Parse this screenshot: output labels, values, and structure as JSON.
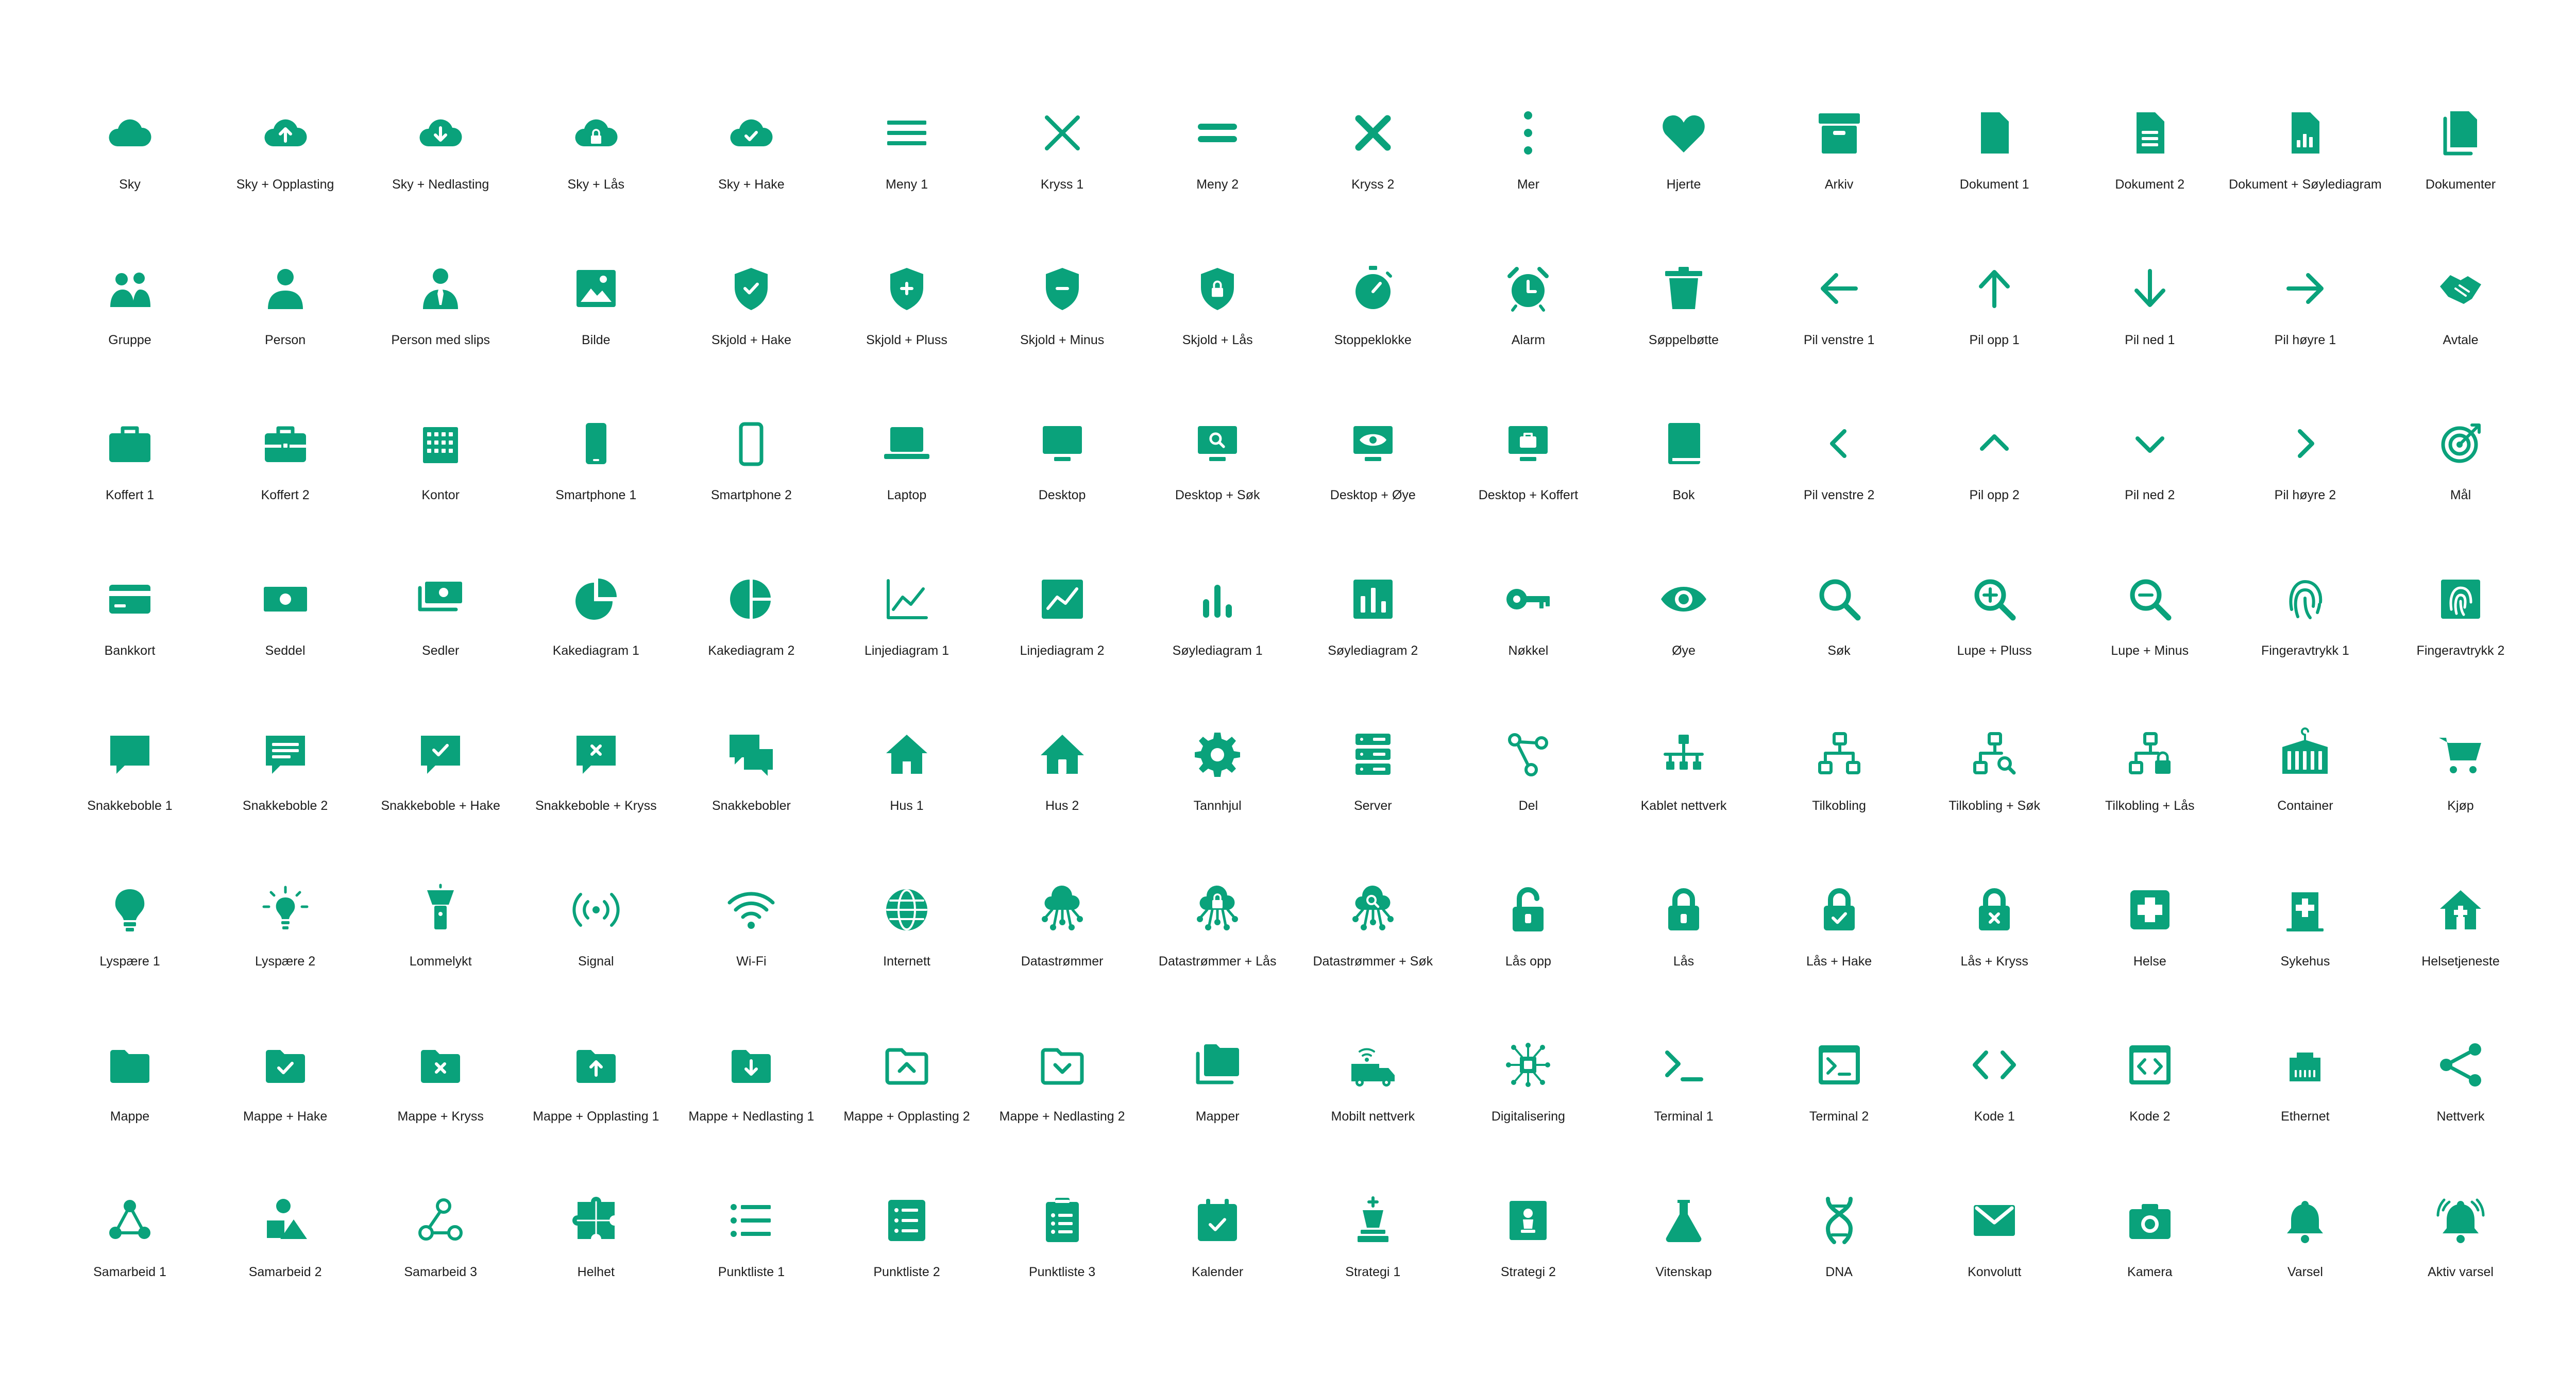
{
  "accent": "#0aa27b",
  "icons": [
    [
      {
        "label": "Sky",
        "icon": "cloud-icon"
      },
      {
        "label": "Sky + Opplasting",
        "icon": "cloud-upload-icon"
      },
      {
        "label": "Sky + Nedlasting",
        "icon": "cloud-download-icon"
      },
      {
        "label": "Sky + Lås",
        "icon": "cloud-lock-icon"
      },
      {
        "label": "Sky + Hake",
        "icon": "cloud-check-icon"
      },
      {
        "label": "Meny 1",
        "icon": "menu-icon"
      },
      {
        "label": "Kryss 1",
        "icon": "close-icon"
      },
      {
        "label": "Meny 2",
        "icon": "menu-two-lines-icon"
      },
      {
        "label": "Kryss 2",
        "icon": "close-bold-icon"
      },
      {
        "label": "Mer",
        "icon": "more-vertical-icon"
      },
      {
        "label": "Hjerte",
        "icon": "heart-icon"
      },
      {
        "label": "Arkiv",
        "icon": "archive-icon"
      },
      {
        "label": "Dokument 1",
        "icon": "document-icon"
      },
      {
        "label": "Dokument 2",
        "icon": "document-lines-icon"
      },
      {
        "label": "Dokument + Søylediagram",
        "icon": "document-chart-icon"
      },
      {
        "label": "Dokumenter",
        "icon": "documents-icon"
      }
    ],
    [
      {
        "label": "Gruppe",
        "icon": "group-icon"
      },
      {
        "label": "Person",
        "icon": "person-icon"
      },
      {
        "label": "Person med slips",
        "icon": "person-tie-icon"
      },
      {
        "label": "Bilde",
        "icon": "image-icon"
      },
      {
        "label": "Skjold + Hake",
        "icon": "shield-check-icon"
      },
      {
        "label": "Skjold + Pluss",
        "icon": "shield-plus-icon"
      },
      {
        "label": "Skjold + Minus",
        "icon": "shield-minus-icon"
      },
      {
        "label": "Skjold + Lås",
        "icon": "shield-lock-icon"
      },
      {
        "label": "Stoppeklokke",
        "icon": "stopwatch-icon"
      },
      {
        "label": "Alarm",
        "icon": "alarm-clock-icon"
      },
      {
        "label": "Søppelbøtte",
        "icon": "trash-icon"
      },
      {
        "label": "Pil venstre 1",
        "icon": "arrow-left-icon"
      },
      {
        "label": "Pil opp 1",
        "icon": "arrow-up-icon"
      },
      {
        "label": "Pil ned 1",
        "icon": "arrow-down-icon"
      },
      {
        "label": "Pil høyre 1",
        "icon": "arrow-right-icon"
      },
      {
        "label": "Avtale",
        "icon": "handshake-icon"
      }
    ],
    [
      {
        "label": "Koffert 1",
        "icon": "briefcase-icon"
      },
      {
        "label": "Koffert 2",
        "icon": "briefcase-band-icon"
      },
      {
        "label": "Kontor",
        "icon": "office-building-icon"
      },
      {
        "label": "Smartphone 1",
        "icon": "smartphone-icon"
      },
      {
        "label": "Smartphone 2",
        "icon": "smartphone-outline-icon"
      },
      {
        "label": "Laptop",
        "icon": "laptop-icon"
      },
      {
        "label": "Desktop",
        "icon": "desktop-icon"
      },
      {
        "label": "Desktop + Søk",
        "icon": "desktop-search-icon"
      },
      {
        "label": "Desktop + Øye",
        "icon": "desktop-eye-icon"
      },
      {
        "label": "Desktop + Koffert",
        "icon": "desktop-briefcase-icon"
      },
      {
        "label": "Bok",
        "icon": "book-icon"
      },
      {
        "label": "Pil venstre 2",
        "icon": "chevron-left-icon"
      },
      {
        "label": "Pil opp 2",
        "icon": "chevron-up-icon"
      },
      {
        "label": "Pil ned 2",
        "icon": "chevron-down-icon"
      },
      {
        "label": "Pil høyre 2",
        "icon": "chevron-right-icon"
      },
      {
        "label": "Mål",
        "icon": "target-icon"
      }
    ],
    [
      {
        "label": "Bankkort",
        "icon": "credit-card-icon"
      },
      {
        "label": "Seddel",
        "icon": "banknote-icon"
      },
      {
        "label": "Sedler",
        "icon": "banknotes-icon"
      },
      {
        "label": "Kakediagram 1",
        "icon": "pie-chart-icon"
      },
      {
        "label": "Kakediagram 2",
        "icon": "pie-chart-split-icon"
      },
      {
        "label": "Linjediagram 1",
        "icon": "line-chart-icon"
      },
      {
        "label": "Linjediagram 2",
        "icon": "line-chart-box-icon"
      },
      {
        "label": "Søylediagram 1",
        "icon": "bar-chart-icon"
      },
      {
        "label": "Søylediagram 2",
        "icon": "bar-chart-box-icon"
      },
      {
        "label": "Nøkkel",
        "icon": "key-icon"
      },
      {
        "label": "Øye",
        "icon": "eye-icon"
      },
      {
        "label": "Søk",
        "icon": "search-icon"
      },
      {
        "label": "Lupe + Pluss",
        "icon": "zoom-in-icon"
      },
      {
        "label": "Lupe + Minus",
        "icon": "zoom-out-icon"
      },
      {
        "label": "Fingeravtrykk 1",
        "icon": "fingerprint-icon"
      },
      {
        "label": "Fingeravtrykk 2",
        "icon": "fingerprint-box-icon"
      }
    ],
    [
      {
        "label": "Snakkeboble 1",
        "icon": "chat-bubble-icon"
      },
      {
        "label": "Snakkeboble 2",
        "icon": "chat-bubble-text-icon"
      },
      {
        "label": "Snakkeboble + Hake",
        "icon": "chat-bubble-check-icon"
      },
      {
        "label": "Snakkeboble + Kryss",
        "icon": "chat-bubble-close-icon"
      },
      {
        "label": "Snakkebobler",
        "icon": "chat-bubbles-icon"
      },
      {
        "label": "Hus 1",
        "icon": "house-icon"
      },
      {
        "label": "Hus 2",
        "icon": "house-roof-icon"
      },
      {
        "label": "Tannhjul",
        "icon": "gear-icon"
      },
      {
        "label": "Server",
        "icon": "server-icon"
      },
      {
        "label": "Del",
        "icon": "share-nodes-icon"
      },
      {
        "label": "Kablet nettverk",
        "icon": "wired-network-icon"
      },
      {
        "label": "Tilkobling",
        "icon": "connection-icon"
      },
      {
        "label": "Tilkobling + Søk",
        "icon": "connection-search-icon"
      },
      {
        "label": "Tilkobling + Lås",
        "icon": "connection-lock-icon"
      },
      {
        "label": "Container",
        "icon": "container-icon"
      },
      {
        "label": "Kjøp",
        "icon": "cart-icon"
      }
    ],
    [
      {
        "label": "Lyspære 1",
        "icon": "lightbulb-icon"
      },
      {
        "label": "Lyspære 2",
        "icon": "lightbulb-rays-icon"
      },
      {
        "label": "Lommelykt",
        "icon": "flashlight-icon"
      },
      {
        "label": "Signal",
        "icon": "signal-icon"
      },
      {
        "label": "Wi-Fi",
        "icon": "wifi-icon"
      },
      {
        "label": "Internett",
        "icon": "globe-icon"
      },
      {
        "label": "Datastrømmer",
        "icon": "cloud-network-icon"
      },
      {
        "label": "Datastrømmer + Lås",
        "icon": "cloud-network-lock-icon"
      },
      {
        "label": "Datastrømmer + Søk",
        "icon": "cloud-network-search-icon"
      },
      {
        "label": "Lås opp",
        "icon": "unlock-icon"
      },
      {
        "label": "Lås",
        "icon": "lock-icon"
      },
      {
        "label": "Lås + Hake",
        "icon": "lock-check-icon"
      },
      {
        "label": "Lås + Kryss",
        "icon": "lock-close-icon"
      },
      {
        "label": "Helse",
        "icon": "health-cross-icon"
      },
      {
        "label": "Sykehus",
        "icon": "hospital-icon"
      },
      {
        "label": "Helsetjeneste",
        "icon": "health-house-icon"
      }
    ],
    [
      {
        "label": "Mappe",
        "icon": "folder-icon"
      },
      {
        "label": "Mappe + Hake",
        "icon": "folder-check-icon"
      },
      {
        "label": "Mappe + Kryss",
        "icon": "folder-close-icon"
      },
      {
        "label": "Mappe + Opplasting 1",
        "icon": "folder-upload-icon"
      },
      {
        "label": "Mappe + Nedlasting 1",
        "icon": "folder-download-icon"
      },
      {
        "label": "Mappe + Opplasting 2",
        "icon": "folder-upload-chevron-icon"
      },
      {
        "label": "Mappe + Nedlasting 2",
        "icon": "folder-download-chevron-icon"
      },
      {
        "label": "Mapper",
        "icon": "folders-icon"
      },
      {
        "label": "Mobilt nettverk",
        "icon": "mobile-network-van-icon"
      },
      {
        "label": "Digitalisering",
        "icon": "chip-network-icon"
      },
      {
        "label": "Terminal 1",
        "icon": "terminal-icon"
      },
      {
        "label": "Terminal 2",
        "icon": "terminal-box-icon"
      },
      {
        "label": "Kode 1",
        "icon": "code-icon"
      },
      {
        "label": "Kode 2",
        "icon": "code-box-icon"
      },
      {
        "label": "Ethernet",
        "icon": "ethernet-icon"
      },
      {
        "label": "Nettverk",
        "icon": "network-share-icon"
      }
    ],
    [
      {
        "label": "Samarbeid 1",
        "icon": "collaboration-icon"
      },
      {
        "label": "Samarbeid 2",
        "icon": "shapes-icon"
      },
      {
        "label": "Samarbeid 3",
        "icon": "collaboration-outline-icon"
      },
      {
        "label": "Helhet",
        "icon": "puzzle-icon"
      },
      {
        "label": "Punktliste 1",
        "icon": "bullet-list-icon"
      },
      {
        "label": "Punktliste 2",
        "icon": "bullet-list-box-icon"
      },
      {
        "label": "Punktliste 3",
        "icon": "clipboard-list-icon"
      },
      {
        "label": "Kalender",
        "icon": "calendar-check-icon"
      },
      {
        "label": "Strategi 1",
        "icon": "chess-king-icon"
      },
      {
        "label": "Strategi 2",
        "icon": "chess-box-icon"
      },
      {
        "label": "Vitenskap",
        "icon": "flask-icon"
      },
      {
        "label": "DNA",
        "icon": "dna-icon"
      },
      {
        "label": "Konvolutt",
        "icon": "envelope-icon"
      },
      {
        "label": "Kamera",
        "icon": "camera-icon"
      },
      {
        "label": "Varsel",
        "icon": "bell-icon"
      },
      {
        "label": "Aktiv varsel",
        "icon": "bell-active-icon"
      }
    ]
  ]
}
